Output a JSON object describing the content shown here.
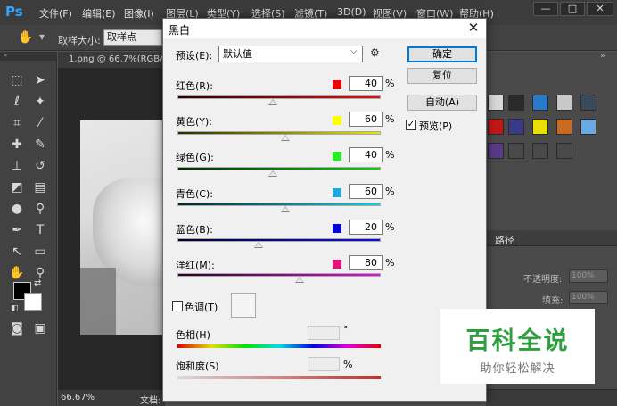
{
  "app": {
    "logo": "Ps"
  },
  "menubar": {
    "items": [
      "文件(F)",
      "编辑(E)",
      "图像(I)",
      "图层(L)",
      "类型(Y)",
      "选择(S)",
      "滤镜(T)",
      "3D(D)",
      "视图(V)",
      "窗口(W)",
      "帮助(H)"
    ],
    "window_controls": [
      "—",
      "□",
      "✕"
    ]
  },
  "options_bar": {
    "sample_size_label": "取样大小:",
    "sample_size_value": "取样点"
  },
  "document": {
    "tab_title": "1.png @ 66.7%(RGB/8#",
    "zoom": "66.67%",
    "doc_label": "文档:"
  },
  "panels": {
    "paths_tab": "路径",
    "opacity_label": "不透明度:",
    "opacity_value": "100%",
    "fill_label": "填充:",
    "fill_value": "100%"
  },
  "dialog": {
    "title": "黑白",
    "preset_label": "预设(E):",
    "preset_value": "默认值",
    "ok": "确定",
    "reset": "复位",
    "auto": "自动(A)",
    "preview": "预览(P)",
    "preview_checked": true,
    "channels": [
      {
        "label": "红色(R):",
        "value": "40",
        "swatch": "#ee0000",
        "track": [
          "#2a0000",
          "#e01010"
        ],
        "fraction": 0.47
      },
      {
        "label": "黄色(Y):",
        "value": "60",
        "swatch": "#ffff00",
        "track": [
          "#2a2a00",
          "#e8e800"
        ],
        "fraction": 0.53
      },
      {
        "label": "绿色(G):",
        "value": "40",
        "swatch": "#22ee22",
        "track": [
          "#002a00",
          "#10d010"
        ],
        "fraction": 0.47
      },
      {
        "label": "青色(C):",
        "value": "60",
        "swatch": "#1ea6e6",
        "track": [
          "#00262a",
          "#10d0e0"
        ],
        "fraction": 0.53
      },
      {
        "label": "蓝色(B):",
        "value": "20",
        "swatch": "#0000e6",
        "track": [
          "#00002a",
          "#1010e0"
        ],
        "fraction": 0.4
      },
      {
        "label": "洋红(M):",
        "value": "80",
        "swatch": "#e6127a",
        "track": [
          "#2a002a",
          "#e010e0"
        ],
        "fraction": 0.6
      }
    ],
    "percent": "%",
    "tint_label": "色调(T)",
    "hue_label": "色相(H)",
    "hue_unit": "°",
    "saturation_label": "饱和度(S)",
    "saturation_unit": "%"
  },
  "watermark": {
    "title": "百科全说",
    "subtitle": "助你轻松解决"
  }
}
